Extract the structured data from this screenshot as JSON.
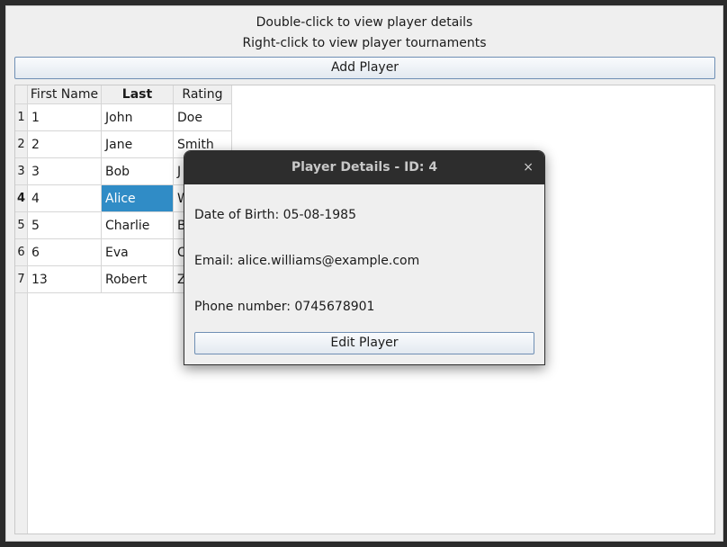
{
  "window": {
    "instruction_1": "Double-click to view player details",
    "instruction_2": "Right-click to view player tournaments",
    "add_button": "Add Player"
  },
  "table": {
    "columns": [
      "First Name",
      "Last Name",
      "Rating"
    ],
    "rows": [
      {
        "header": "1",
        "cells": [
          "1",
          "John",
          "Doe"
        ]
      },
      {
        "header": "2",
        "cells": [
          "2",
          "Jane",
          "Smith"
        ]
      },
      {
        "header": "3",
        "cells": [
          "3",
          "Bob",
          "J"
        ]
      },
      {
        "header": "4",
        "cells": [
          "4",
          "Alice",
          "W"
        ]
      },
      {
        "header": "5",
        "cells": [
          "5",
          "Charlie",
          "B"
        ]
      },
      {
        "header": "6",
        "cells": [
          "6",
          "Eva",
          "C"
        ]
      },
      {
        "header": "7",
        "cells": [
          "13",
          "Robert",
          "Z"
        ]
      }
    ],
    "selected_row_index": 3,
    "selected_column_index": 1,
    "selection_color": "#308cc6"
  },
  "dialog": {
    "title": "Player Details - ID: 4",
    "close_icon": "×",
    "dob": "Date of Birth: 05-08-1985",
    "email": "Email: alice.williams@example.com",
    "phone": "Phone number: 0745678901",
    "edit_button": "Edit Player"
  }
}
